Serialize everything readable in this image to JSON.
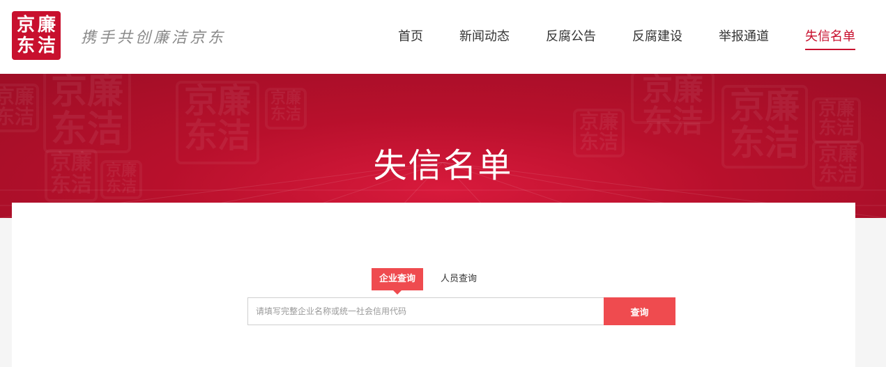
{
  "logo": {
    "chars": [
      "京",
      "廉",
      "东",
      "洁"
    ]
  },
  "slogan": "携手共创廉洁京东",
  "nav": {
    "items": [
      {
        "label": "首页",
        "active": false
      },
      {
        "label": "新闻动态",
        "active": false
      },
      {
        "label": "反腐公告",
        "active": false
      },
      {
        "label": "反腐建设",
        "active": false
      },
      {
        "label": "举报通道",
        "active": false
      },
      {
        "label": "失信名单",
        "active": true
      }
    ]
  },
  "banner": {
    "title": "失信名单"
  },
  "search": {
    "tabs": [
      {
        "label": "企业查询",
        "active": true
      },
      {
        "label": "人员查询",
        "active": false
      }
    ],
    "placeholder": "请填写完整企业名称或统一社会信用代码",
    "value": "",
    "button_label": "查询"
  },
  "colors": {
    "brand": "#c8102e",
    "accent": "#ef4b4f"
  }
}
